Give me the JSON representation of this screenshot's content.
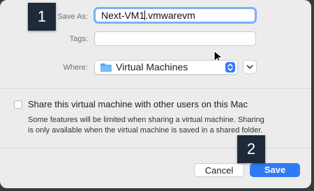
{
  "dialog": {
    "save_as_label": "Save As:",
    "filename_prefix": "Next-VM1",
    "filename_suffix": ".vmwarevm",
    "tags_label": "Tags:",
    "tags_value": "",
    "where_label": "Where:",
    "where_value": "Virtual Machines",
    "share_checkbox_label": "Share this virtual machine with other users on this Mac",
    "share_checked": false,
    "share_note": "Some features will be limited when sharing a virtual machine. Sharing is only available when the virtual machine is saved in a shared folder.",
    "cancel_label": "Cancel",
    "save_label": "Save"
  },
  "annotations": {
    "step1": "1",
    "step2": "2"
  },
  "colors": {
    "accent": "#2f7bf6",
    "focus_ring": "#7eaef5",
    "badge": "#1e2a3a"
  },
  "icons": {
    "folder": "folder-icon",
    "stepper": "up-down-chevron-icon",
    "expand": "chevron-down-icon",
    "cursor": "mouse-pointer-icon"
  }
}
